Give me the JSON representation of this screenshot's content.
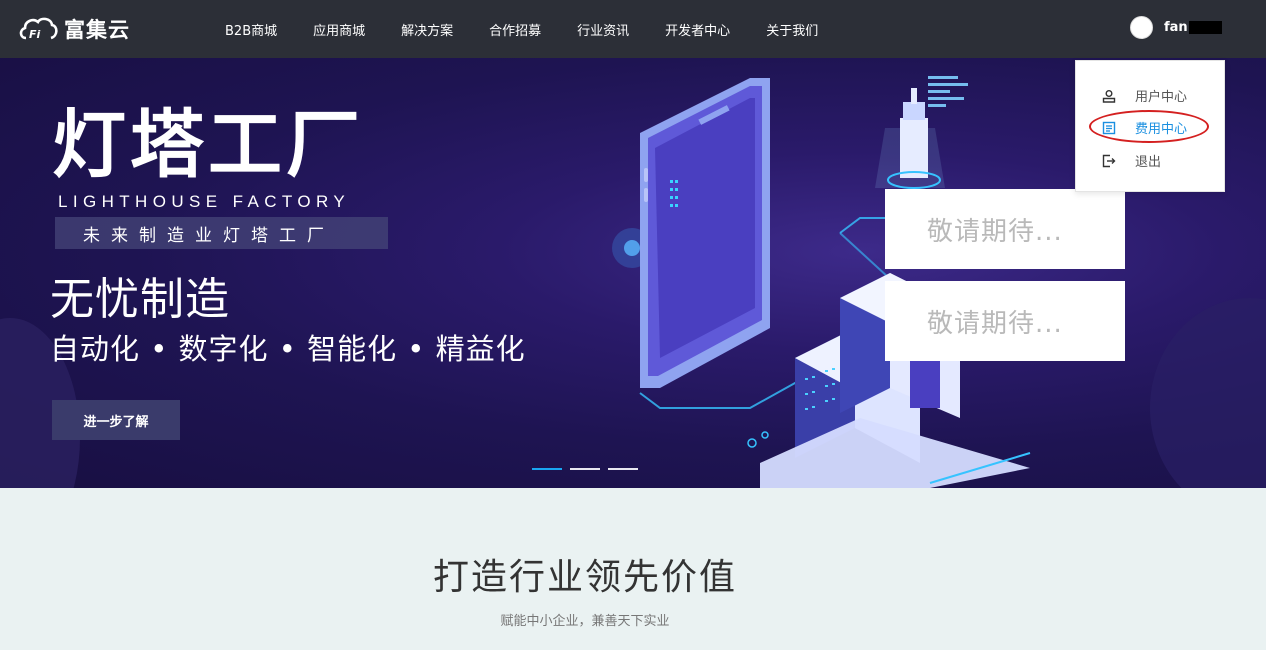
{
  "brand": {
    "name": "富集云"
  },
  "nav": {
    "items": [
      "B2B商城",
      "应用商城",
      "解决方案",
      "合作招募",
      "行业资讯",
      "开发者中心",
      "关于我们"
    ]
  },
  "user": {
    "name_visible": "fan"
  },
  "hero": {
    "title": "灯塔工厂",
    "title_en": "LIGHTHOUSE FACTORY",
    "subtitle": "未来制造业灯塔工厂",
    "heading": "无忧制造",
    "tagline": "自动化 • 数字化 • 智能化 • 精益化",
    "button_label": "进一步了解",
    "carousel": {
      "count": 3,
      "active_index": 0
    }
  },
  "coming_soon": [
    "敬请期待...",
    "敬请期待..."
  ],
  "user_menu": {
    "items": [
      {
        "label": "用户中心",
        "icon": "user-center-icon",
        "active": false
      },
      {
        "label": "费用中心",
        "icon": "billing-icon",
        "active": true
      },
      {
        "label": "退出",
        "icon": "logout-icon",
        "active": false
      }
    ]
  },
  "section": {
    "title": "打造行业领先价值",
    "subtitle": "赋能中小企业，兼善天下实业"
  },
  "colors": {
    "navbar": "#2c2f37",
    "accent": "#1a8fe0",
    "annotation": "#d42020",
    "active_dot": "#1aa6f0"
  }
}
